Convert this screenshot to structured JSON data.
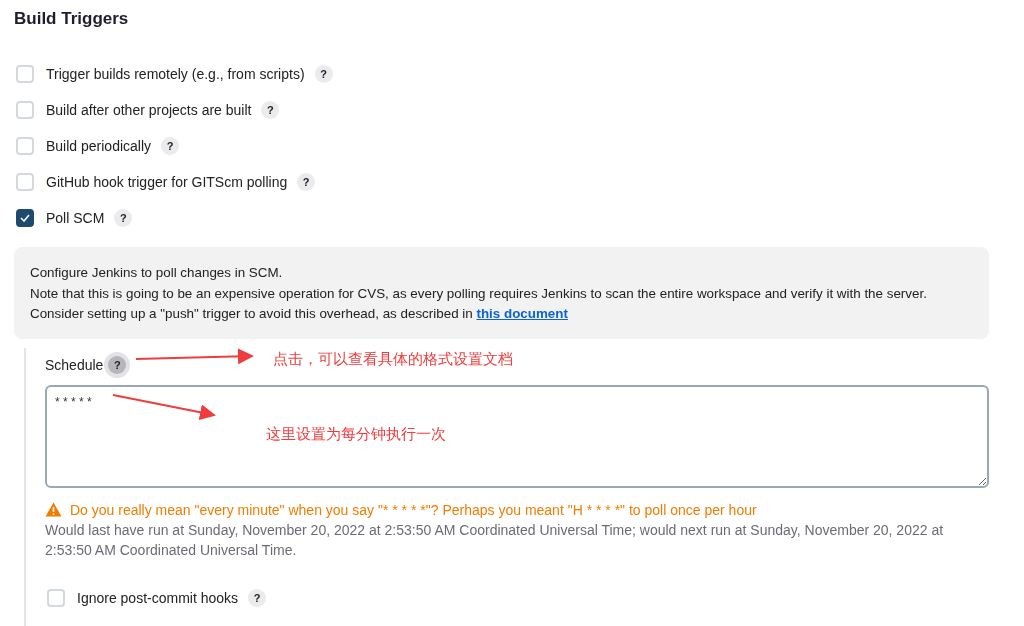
{
  "section_title": "Build Triggers",
  "triggers": [
    {
      "label": "Trigger builds remotely (e.g., from scripts)",
      "checked": false,
      "help": "?"
    },
    {
      "label": "Build after other projects are built",
      "checked": false,
      "help": "?"
    },
    {
      "label": "Build periodically",
      "checked": false,
      "help": "?"
    },
    {
      "label": "GitHub hook trigger for GITScm polling",
      "checked": false,
      "help": "?"
    },
    {
      "label": "Poll SCM",
      "checked": true,
      "help": "?"
    }
  ],
  "info": {
    "lines": [
      "Configure Jenkins to poll changes in SCM.",
      "Note that this is going to be an expensive operation for CVS, as every polling requires Jenkins to scan the entire workspace and verify it with the server."
    ],
    "last_line": "Consider setting up a \"push\" trigger to avoid this overhead, as described in ",
    "link": "this document"
  },
  "schedule": {
    "label": "Schedule",
    "help": "?",
    "help_active": true,
    "value": "* * * * *"
  },
  "warning": "Do you really mean \"every minute\" when you say \"* * * * *\"? Perhaps you meant \"H * * * *\" to poll once per hour",
  "run_info": "Would last have run at Sunday, November 20, 2022 at 2:53:50 AM Coordinated Universal Time; would next run at Sunday, November 20, 2022 at 2:53:50 AM Coordinated Universal Time.",
  "ignore_hooks": {
    "label": "Ignore post-commit hooks",
    "checked": false,
    "help": "?"
  },
  "annotations": [
    {
      "text": "点击，可以查看具体的格式设置文档",
      "kind": "help"
    },
    {
      "text": "这里设置为每分钟执行一次",
      "kind": "field"
    }
  ]
}
